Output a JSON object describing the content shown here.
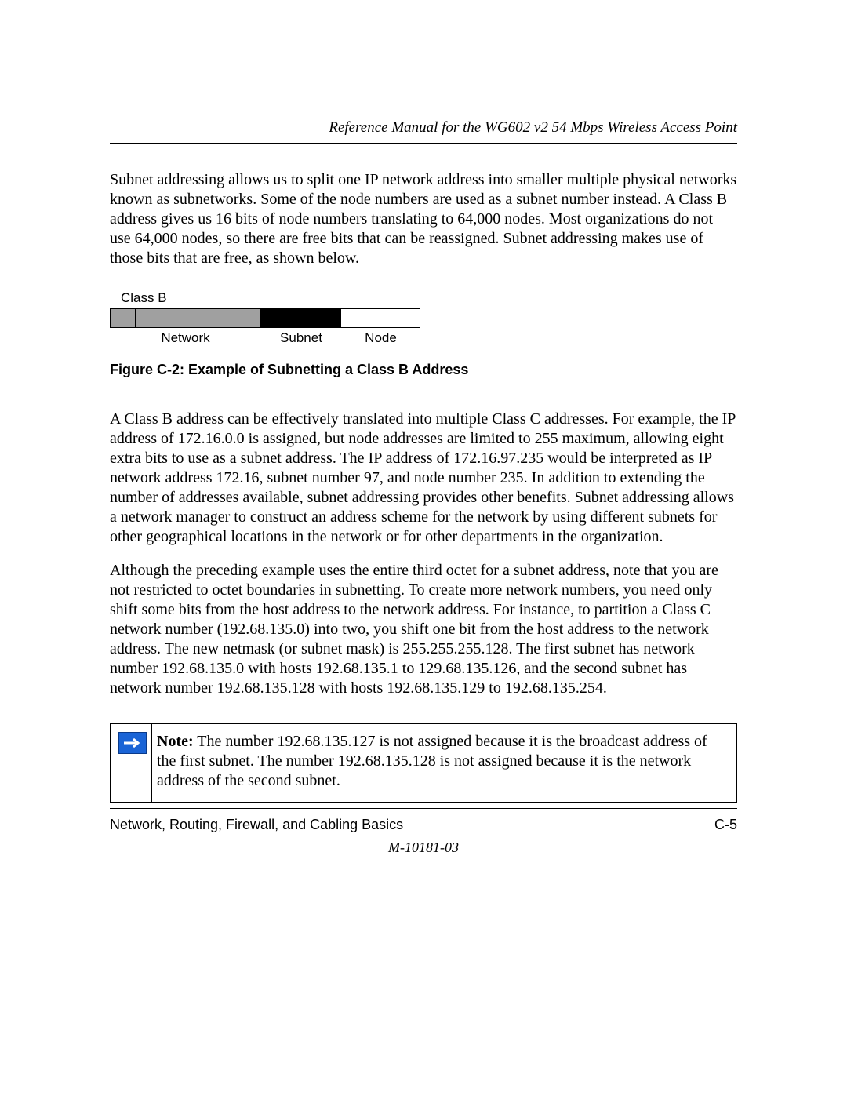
{
  "header_title": "Reference Manual for the WG602 v2 54 Mbps Wireless Access Point",
  "para1": "Subnet addressing allows us to split one IP network address into smaller multiple physical networks known as subnetworks. Some of the node numbers are used as a subnet number instead. A Class B address gives us 16 bits of node numbers translating to 64,000 nodes. Most organizations do not use 64,000 nodes, so there are free bits that can be reassigned. Subnet addressing makes use of those bits that are free, as shown below.",
  "diagram": {
    "top_label": "Class B",
    "label_network": "Network",
    "label_subnet": "Subnet",
    "label_node": "Node"
  },
  "figure_caption": "Figure C-2:  Example of Subnetting a Class B Address",
  "para2": "A Class B address can be effectively translated into multiple Class C addresses. For example, the IP address of 172.16.0.0 is assigned, but node addresses are limited to 255 maximum, allowing eight extra bits to use as a subnet address. The IP address of 172.16.97.235 would be interpreted as IP network address 172.16, subnet number 97, and node number 235. In addition to extending the number of addresses available, subnet addressing provides other benefits. Subnet addressing allows a network manager to construct an address scheme for the network by using different subnets for other geographical locations in the network or for other departments in the organization.",
  "para3": "Although the preceding example uses the entire third octet for a subnet address, note that you are not restricted to octet boundaries in subnetting. To create more network numbers, you need only shift some bits from the host address to the network address. For instance, to partition a Class C network number (192.68.135.0) into two, you shift one bit from the host address to the network address. The new netmask (or subnet mask) is 255.255.255.128. The first subnet has network number 192.68.135.0 with hosts 192.68.135.1 to 129.68.135.126, and the second subnet has network number 192.68.135.128 with hosts 192.68.135.129 to 192.68.135.254.",
  "note": {
    "label": "Note:",
    "text": " The number 192.68.135.127 is not assigned because it is the broadcast address of the first subnet. The number 192.68.135.128 is not assigned because it is the network address of the second subnet."
  },
  "footer": {
    "left": "Network, Routing, Firewall, and Cabling Basics",
    "right": "C-5",
    "docnum": "M-10181-03"
  }
}
